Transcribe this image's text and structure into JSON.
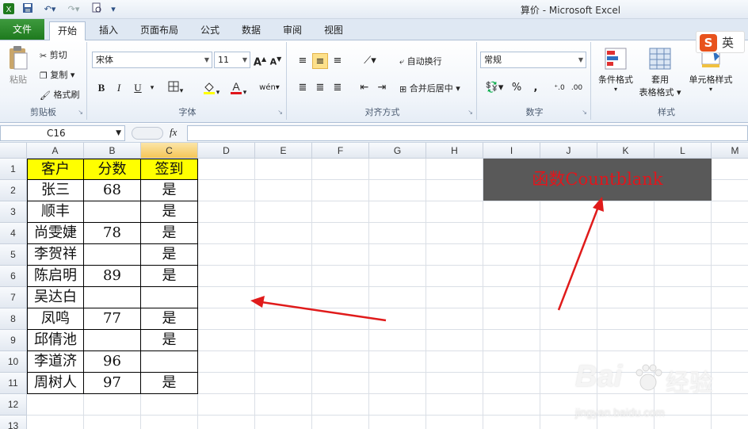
{
  "window": {
    "title": "算价 - Microsoft Excel"
  },
  "ribbon_tabs": [
    "文件",
    "开始",
    "插入",
    "页面布局",
    "公式",
    "数据",
    "审阅",
    "视图"
  ],
  "active_tab": "开始",
  "clipboard": {
    "paste": "粘贴",
    "cut": "剪切",
    "copy": "复制",
    "format_painter": "格式刷",
    "label": "剪贴板"
  },
  "font": {
    "name": "宋体",
    "size": "11",
    "label": "字体",
    "bold": "B",
    "italic": "I",
    "underline": "U",
    "grow": "A",
    "shrink": "A"
  },
  "alignment": {
    "wrap": "自动换行",
    "merge": "合并后居中",
    "label": "对齐方式"
  },
  "number": {
    "format": "常规",
    "percent": "%",
    "comma": ",",
    "label": "数字"
  },
  "styles": {
    "conditional": "条件格式",
    "table_line1": "套用",
    "table_line2": "表格格式",
    "cell_styles": "单元格样式",
    "label": "样式"
  },
  "ime": {
    "logo": "S",
    "lang": "英"
  },
  "formula_bar": {
    "name_box": "C16",
    "fx": "fx",
    "value": ""
  },
  "columns": [
    "A",
    "B",
    "C",
    "D",
    "E",
    "F",
    "G",
    "H",
    "I",
    "J",
    "K",
    "L",
    "M"
  ],
  "selected_column": "C",
  "rows": [
    "1",
    "2",
    "3",
    "4",
    "5",
    "6",
    "7",
    "8",
    "9",
    "10",
    "11",
    "12",
    "13"
  ],
  "table": {
    "header": [
      "客户",
      "分数",
      "签到"
    ],
    "data": [
      [
        "张三",
        "68",
        "是"
      ],
      [
        "顺丰",
        "",
        "是"
      ],
      [
        "尚雯婕",
        "78",
        "是"
      ],
      [
        "李贺祥",
        "",
        "是"
      ],
      [
        "陈启明",
        "89",
        "是"
      ],
      [
        "吴达白",
        "",
        ""
      ],
      [
        "凤鸣",
        "77",
        "是"
      ],
      [
        "邱倩池",
        "",
        "是"
      ],
      [
        "李道济",
        "96",
        ""
      ],
      [
        "周树人",
        "97",
        "是"
      ]
    ]
  },
  "annotation": {
    "text": "函数Countblank",
    "color": "#e0161c",
    "box_color": "#595959"
  },
  "colors": {
    "header_fill": "#ffff00",
    "arrow": "#e01b1b",
    "file_tab": "#2a8a2a"
  },
  "watermark": {
    "brand": "Bai",
    "brand_cn": "经验",
    "url": "jingyan.baidu.com"
  }
}
